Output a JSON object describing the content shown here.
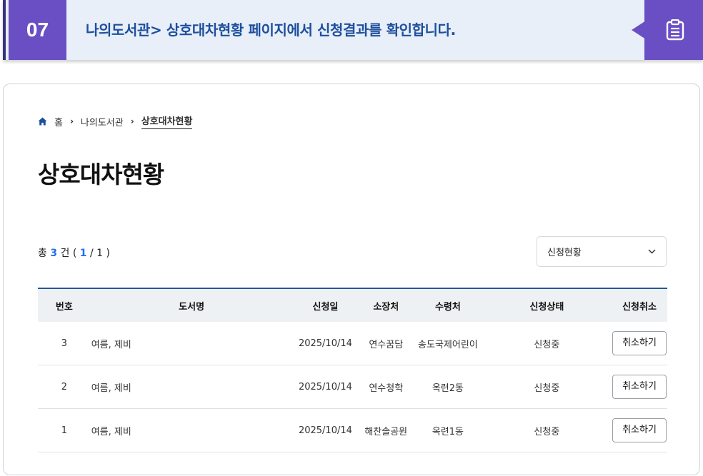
{
  "banner": {
    "step": "07",
    "text": "나의도서관> 상호대차현황 페이지에서 신청결과를 확인합니다.",
    "icon": "clipboard-icon"
  },
  "breadcrumb": {
    "home": "홈",
    "level1": "나의도서관",
    "current": "상호대차현황"
  },
  "page_title": "상호대차현황",
  "count": {
    "prefix": "총",
    "total": "3",
    "unit": "건 (",
    "page": "1",
    "sep": "/",
    "pages": "1",
    "suffix": ")"
  },
  "filter": {
    "selected": "신청현황"
  },
  "table": {
    "headers": [
      "번호",
      "도서명",
      "신청일",
      "소장처",
      "수령처",
      "신청상태",
      "신청취소"
    ],
    "rows": [
      {
        "no": "3",
        "title": "여름, 제비",
        "date": "2025/10/14",
        "holder": "연수꿈담",
        "receive": "송도국제어린이",
        "status": "신청중",
        "cancel": "취소하기"
      },
      {
        "no": "2",
        "title": "여름, 제비",
        "date": "2025/10/14",
        "holder": "연수청학",
        "receive": "옥련2동",
        "status": "신청중",
        "cancel": "취소하기"
      },
      {
        "no": "1",
        "title": "여름, 제비",
        "date": "2025/10/14",
        "holder": "해찬솔공원",
        "receive": "옥련1동",
        "status": "신청중",
        "cancel": "취소하기"
      }
    ]
  },
  "colors": {
    "accent": "#6a4fc4",
    "banner_bg": "#e8eff8",
    "link": "#256ef4",
    "table_top": "#23579c"
  }
}
